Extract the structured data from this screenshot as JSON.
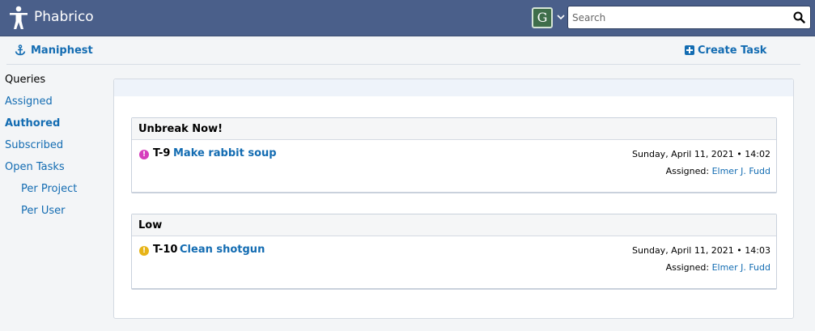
{
  "app": {
    "title": "Phabrico",
    "avatar_letter": "G"
  },
  "search": {
    "placeholder": "Search",
    "value": ""
  },
  "header": {
    "breadcrumb": "Maniphest",
    "create_task_label": "Create Task"
  },
  "sidebar": {
    "heading": "Queries",
    "items": [
      {
        "label": "Assigned"
      },
      {
        "label": "Authored"
      },
      {
        "label": "Subscribed"
      },
      {
        "label": "Open Tasks"
      },
      {
        "label": "Per Project"
      },
      {
        "label": "Per User"
      }
    ]
  },
  "groups": [
    {
      "name": "Unbreak Now!",
      "tasks": [
        {
          "id": "T-9",
          "title": "Make rabbit soup",
          "date": "Sunday, April 11, 2021 • 14:02",
          "assigned_label": "Assigned:",
          "assignee": "Elmer J. Fudd",
          "priority_color": "#d63dbd"
        }
      ]
    },
    {
      "name": "Low",
      "tasks": [
        {
          "id": "T-10",
          "title": "Clean shotgun",
          "date": "Sunday, April 11, 2021 • 14:03",
          "assigned_label": "Assigned:",
          "assignee": "Elmer J. Fudd",
          "priority_color": "#e7b418"
        }
      ]
    }
  ],
  "colors": {
    "topbar": "#4a5f8a",
    "link": "#136cb2",
    "background": "#f3f5f7"
  },
  "icons": {
    "logo": "person-icon",
    "breadcrumb": "anchor-icon",
    "create": "plus-square-icon",
    "search": "search-icon",
    "priority": "exclamation-circle-icon"
  }
}
